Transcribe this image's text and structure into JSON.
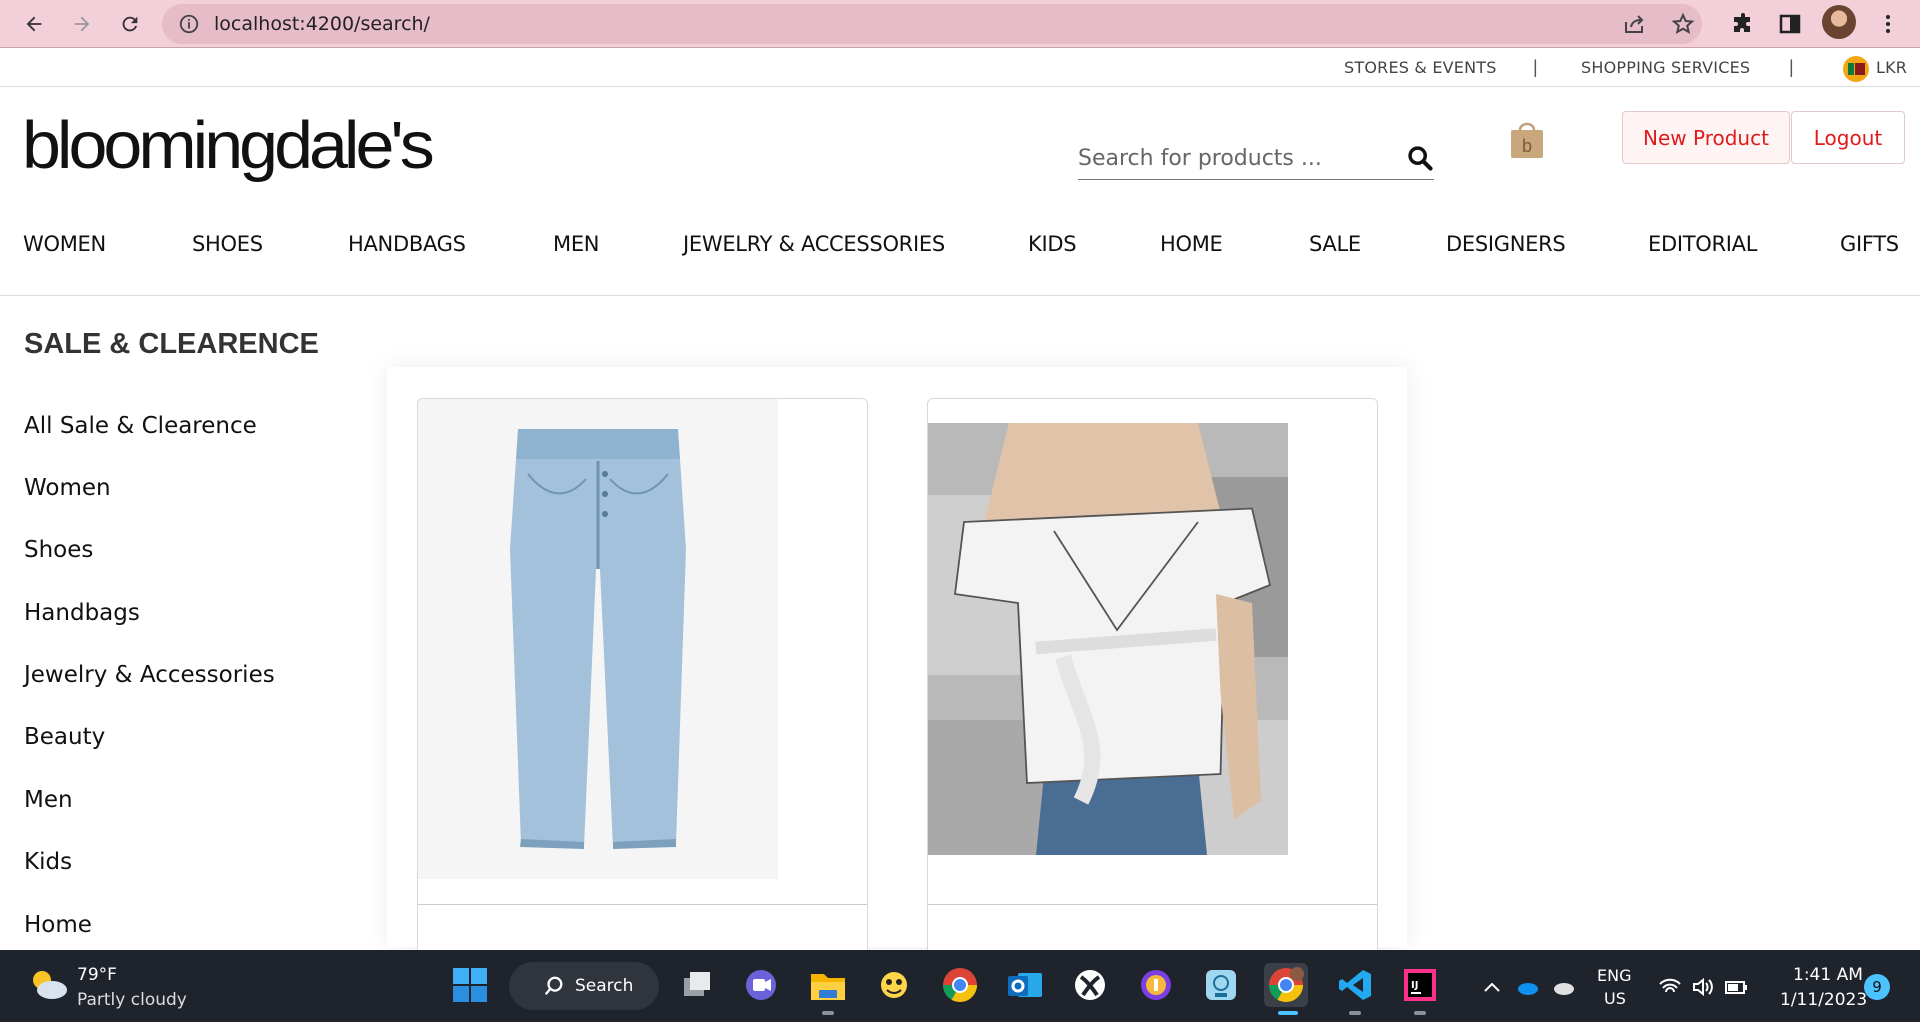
{
  "browser": {
    "url": "localhost:4200/search/"
  },
  "utility": {
    "links": [
      "STORES & EVENTS",
      "SHOPPING SERVICES"
    ],
    "separator": "|",
    "currency": "LKR"
  },
  "header": {
    "logo_text": "bloomingdale's",
    "search_placeholder": "Search for products ...",
    "new_product_label": "New Product",
    "logout_label": "Logout",
    "brand_color": "#e01b1b"
  },
  "categories": [
    "WOMEN",
    "SHOES",
    "HANDBAGS",
    "MEN",
    "JEWELRY & ACCESSORIES",
    "KIDS",
    "HOME",
    "SALE",
    "DESIGNERS",
    "EDITORIAL",
    "GIFTS"
  ],
  "sidebar": {
    "title": "SALE & CLEARENCE",
    "items": [
      "All Sale & Clearence",
      "Women",
      "Shoes",
      "Handbags",
      "Jewelry & Accessories",
      "Beauty",
      "Men",
      "Kids",
      "Home"
    ]
  },
  "products": [
    {
      "image": "denim-jeans"
    },
    {
      "image": "white-wrap-top"
    }
  ],
  "taskbar": {
    "weather_temp": "79°F",
    "weather_desc": "Partly cloudy",
    "search_label": "Search",
    "lang_top": "ENG",
    "lang_bottom": "US",
    "time": "1:41 AM",
    "date": "1/11/2023",
    "notification_count": "9"
  }
}
